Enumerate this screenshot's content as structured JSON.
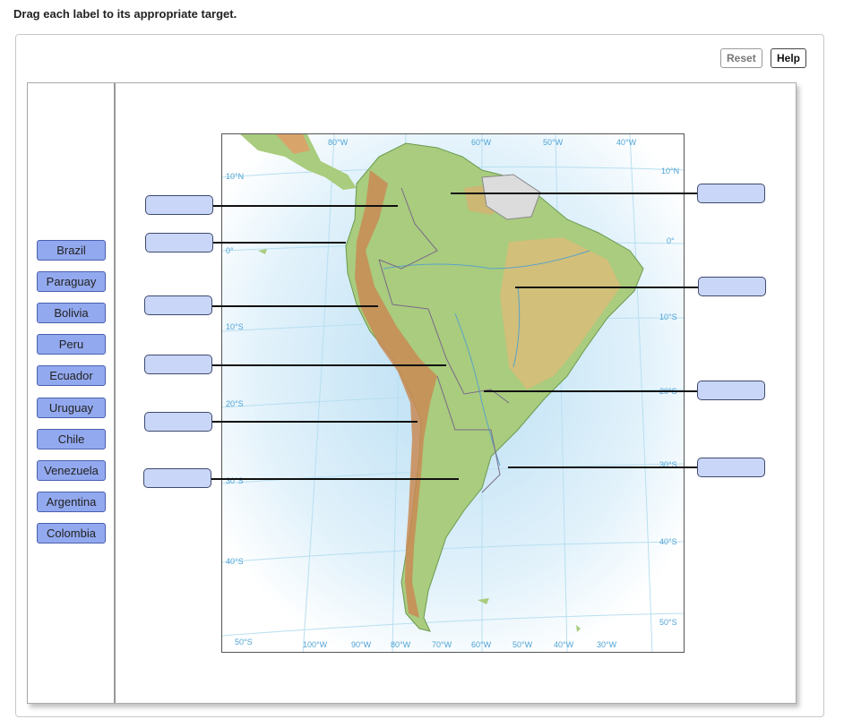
{
  "instruction": "Drag each label to its appropriate target.",
  "buttons": {
    "reset": "Reset",
    "help": "Help"
  },
  "labels": [
    "Brazil",
    "Paraguay",
    "Bolivia",
    "Peru",
    "Ecuador",
    "Uruguay",
    "Chile",
    "Venezuela",
    "Argentina",
    "Colombia"
  ],
  "map": {
    "top_longitudes": [
      "80°W",
      "60°W",
      "50°W",
      "40°W"
    ],
    "bottom_longitudes": [
      "100°W",
      "90°W",
      "80°W",
      "70°W",
      "60°W",
      "50°W",
      "40°W",
      "30°W"
    ],
    "left_latitudes": [
      "10°N",
      "0°",
      "10°S",
      "20°S",
      "30°S",
      "40°S",
      "50°S"
    ],
    "right_latitudes": [
      "10°N",
      "0°",
      "10°S",
      "20°S",
      "30°S",
      "40°S",
      "50°S"
    ]
  },
  "colors": {
    "label_fill": "#93a9ef",
    "target_fill": "#c9d6f7",
    "land": "#a9cc7e",
    "highland": "#d8a46a",
    "ocean": "#d9eef8"
  }
}
